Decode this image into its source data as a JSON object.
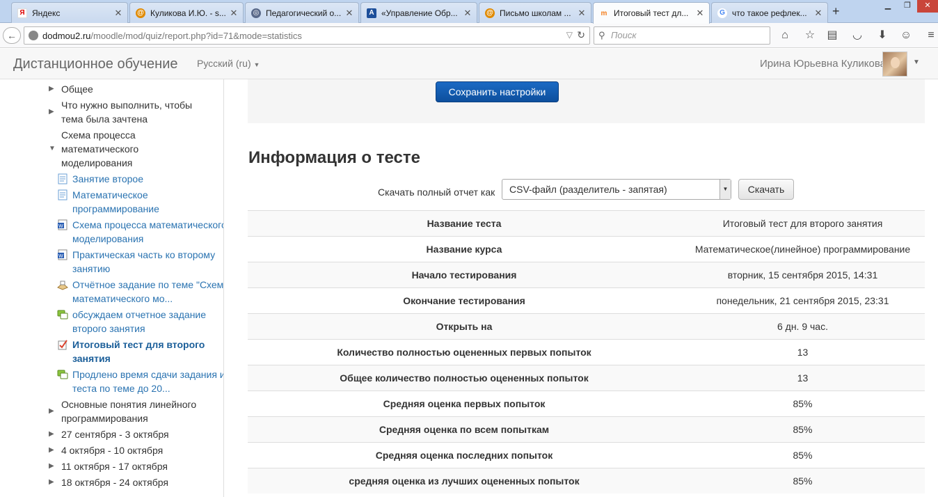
{
  "browser": {
    "tabs": [
      {
        "title": "Яндекс",
        "icon": "yandex-icon",
        "active": false
      },
      {
        "title": "Куликова И.Ю. - s...",
        "icon": "mail-icon",
        "active": false
      },
      {
        "title": "Педагогический о...",
        "icon": "globe-icon",
        "active": false
      },
      {
        "title": "«Управление Обр...",
        "icon": "document-icon",
        "active": false
      },
      {
        "title": "Письмо школам ...",
        "icon": "mail-icon",
        "active": false
      },
      {
        "title": "Итоговый тест дл...",
        "icon": "moodle-icon",
        "active": true
      },
      {
        "title": "что такое рефлек...",
        "icon": "google-icon",
        "active": false
      }
    ],
    "url_host": "dodmou2.ru",
    "url_path": "/moodle/mod/quiz/report.php?id=71&mode=statistics",
    "search_placeholder": "Поиск"
  },
  "header": {
    "site_name": "Дистанционное обучение",
    "language": "Русский (ru)",
    "user_name": "Ирина Юрьевна Куликова"
  },
  "sidebar": {
    "items": [
      {
        "label": "Общее",
        "kind": "section"
      },
      {
        "label": "Что нужно выполнить, чтобы тема была зачтена",
        "kind": "section"
      },
      {
        "label": "Схема процесса математического моделирования",
        "kind": "section-open"
      },
      {
        "label": "Занятие второе",
        "kind": "page"
      },
      {
        "label": "Математическое программирование",
        "kind": "page"
      },
      {
        "label": "Схема процесса математического моделирования",
        "kind": "word-file"
      },
      {
        "label": "Практическая часть ко второму занятию",
        "kind": "word-file"
      },
      {
        "label": "Отчётное задание по теме \"Схема математического мо...",
        "kind": "assignment"
      },
      {
        "label": "обсуждаем отчетное задание второго занятия",
        "kind": "forum"
      },
      {
        "label": "Итоговый тест для второго занятия",
        "kind": "quiz"
      },
      {
        "label": "Продлено время сдачи задания и теста по теме до 20...",
        "kind": "forum"
      },
      {
        "label": "Основные понятия линейного программирования",
        "kind": "section"
      },
      {
        "label": "27 сентября - 3 октября",
        "kind": "section"
      },
      {
        "label": "4 октября - 10 октября",
        "kind": "section"
      },
      {
        "label": "11 октября - 17 октября",
        "kind": "section"
      },
      {
        "label": "18 октября - 24 октября",
        "kind": "section"
      }
    ]
  },
  "main": {
    "save_button": "Сохранить настройки",
    "heading": "Информация о тесте",
    "download_label": "Скачать полный отчет как",
    "download_format": "CSV-файл (разделитель - запятая)",
    "download_button": "Скачать",
    "stats": [
      {
        "key": "Название теста",
        "value": "Итоговый тест для второго занятия"
      },
      {
        "key": "Название курса",
        "value": "Математическое(линейное) программирование"
      },
      {
        "key": "Начало тестирования",
        "value": "вторник, 15 сентября 2015, 14:31"
      },
      {
        "key": "Окончание тестирования",
        "value": "понедельник, 21 сентября 2015, 23:31"
      },
      {
        "key": "Открыть на",
        "value": "6 дн. 9 час."
      },
      {
        "key": "Количество полностью оцененных первых попыток",
        "value": "13"
      },
      {
        "key": "Общее количество полностью оцененных попыток",
        "value": "13"
      },
      {
        "key": "Средняя оценка первых попыток",
        "value": "85%"
      },
      {
        "key": "Средняя оценка по всем попыткам",
        "value": "85%"
      },
      {
        "key": "Средняя оценка последних попыток",
        "value": "85%"
      },
      {
        "key": "средняя оценка из лучших оцененных попыток",
        "value": "85%"
      }
    ]
  },
  "colors": {
    "link": "#2a73b1",
    "primary_button": "#0d4f9d",
    "header_bg": "#f7f7f7"
  }
}
